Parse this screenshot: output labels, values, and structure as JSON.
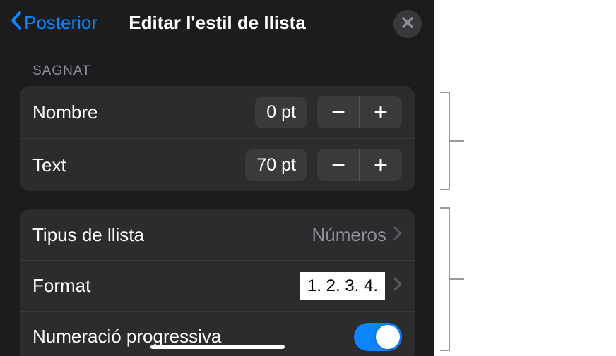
{
  "header": {
    "back_label": "Posterior",
    "title": "Editar l'estil de llista"
  },
  "sections": {
    "indent_label": "SAGNAT"
  },
  "indent": {
    "nombre_label": "Nombre",
    "nombre_value": "0 pt",
    "text_label": "Text",
    "text_value": "70 pt"
  },
  "list": {
    "type_label": "Tipus de llista",
    "type_value": "Números",
    "format_label": "Format",
    "format_value": "1. 2. 3. 4.",
    "progressive_label": "Numeració progressiva"
  }
}
